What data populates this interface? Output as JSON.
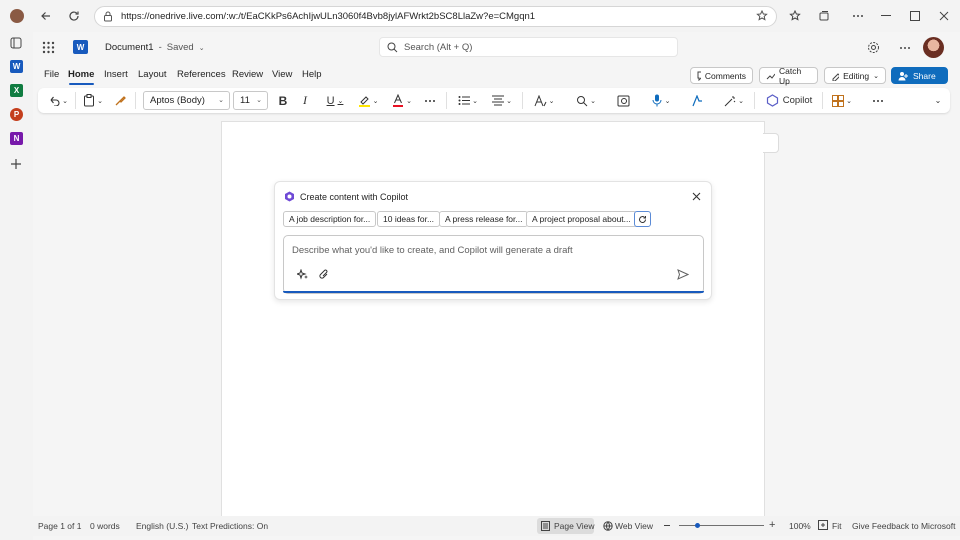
{
  "browser": {
    "url": "https://onedrive.live.com/:w:/t/EaCKkPs6AchIjwULn3060f4Bvb8jylAFWrkt2bSC8LlaZw?e=CMgqn1"
  },
  "app": {
    "doc_title": "Document1",
    "save_status": "Saved",
    "search_placeholder": "Search (Alt + Q)",
    "accent": "#185abd"
  },
  "ribbon": {
    "tabs": [
      "File",
      "Home",
      "Insert",
      "Layout",
      "References",
      "Review",
      "View",
      "Help"
    ],
    "active_tab": "Home",
    "comments_label": "Comments",
    "catchup_label": "Catch Up",
    "editing_label": "Editing",
    "share_label": "Share",
    "font_name": "Aptos (Body)",
    "font_size": "11",
    "copilot_label": "Copilot"
  },
  "copilot": {
    "title": "Create content with Copilot",
    "suggestions": [
      "A job description for...",
      "10 ideas for...",
      "A press release for...",
      "A project proposal about..."
    ],
    "prompt_placeholder": "Describe what you'd like to create, and Copilot will generate a draft"
  },
  "status": {
    "page_info": "Page 1 of 1",
    "word_count": "0 words",
    "language": "English (U.S.)",
    "text_predictions": "Text Predictions: On",
    "page_view": "Page View",
    "web_view": "Web View",
    "zoom": "100%",
    "zoom_fraction": 0.22,
    "fit": "Fit",
    "feedback": "Give Feedback to Microsoft"
  }
}
